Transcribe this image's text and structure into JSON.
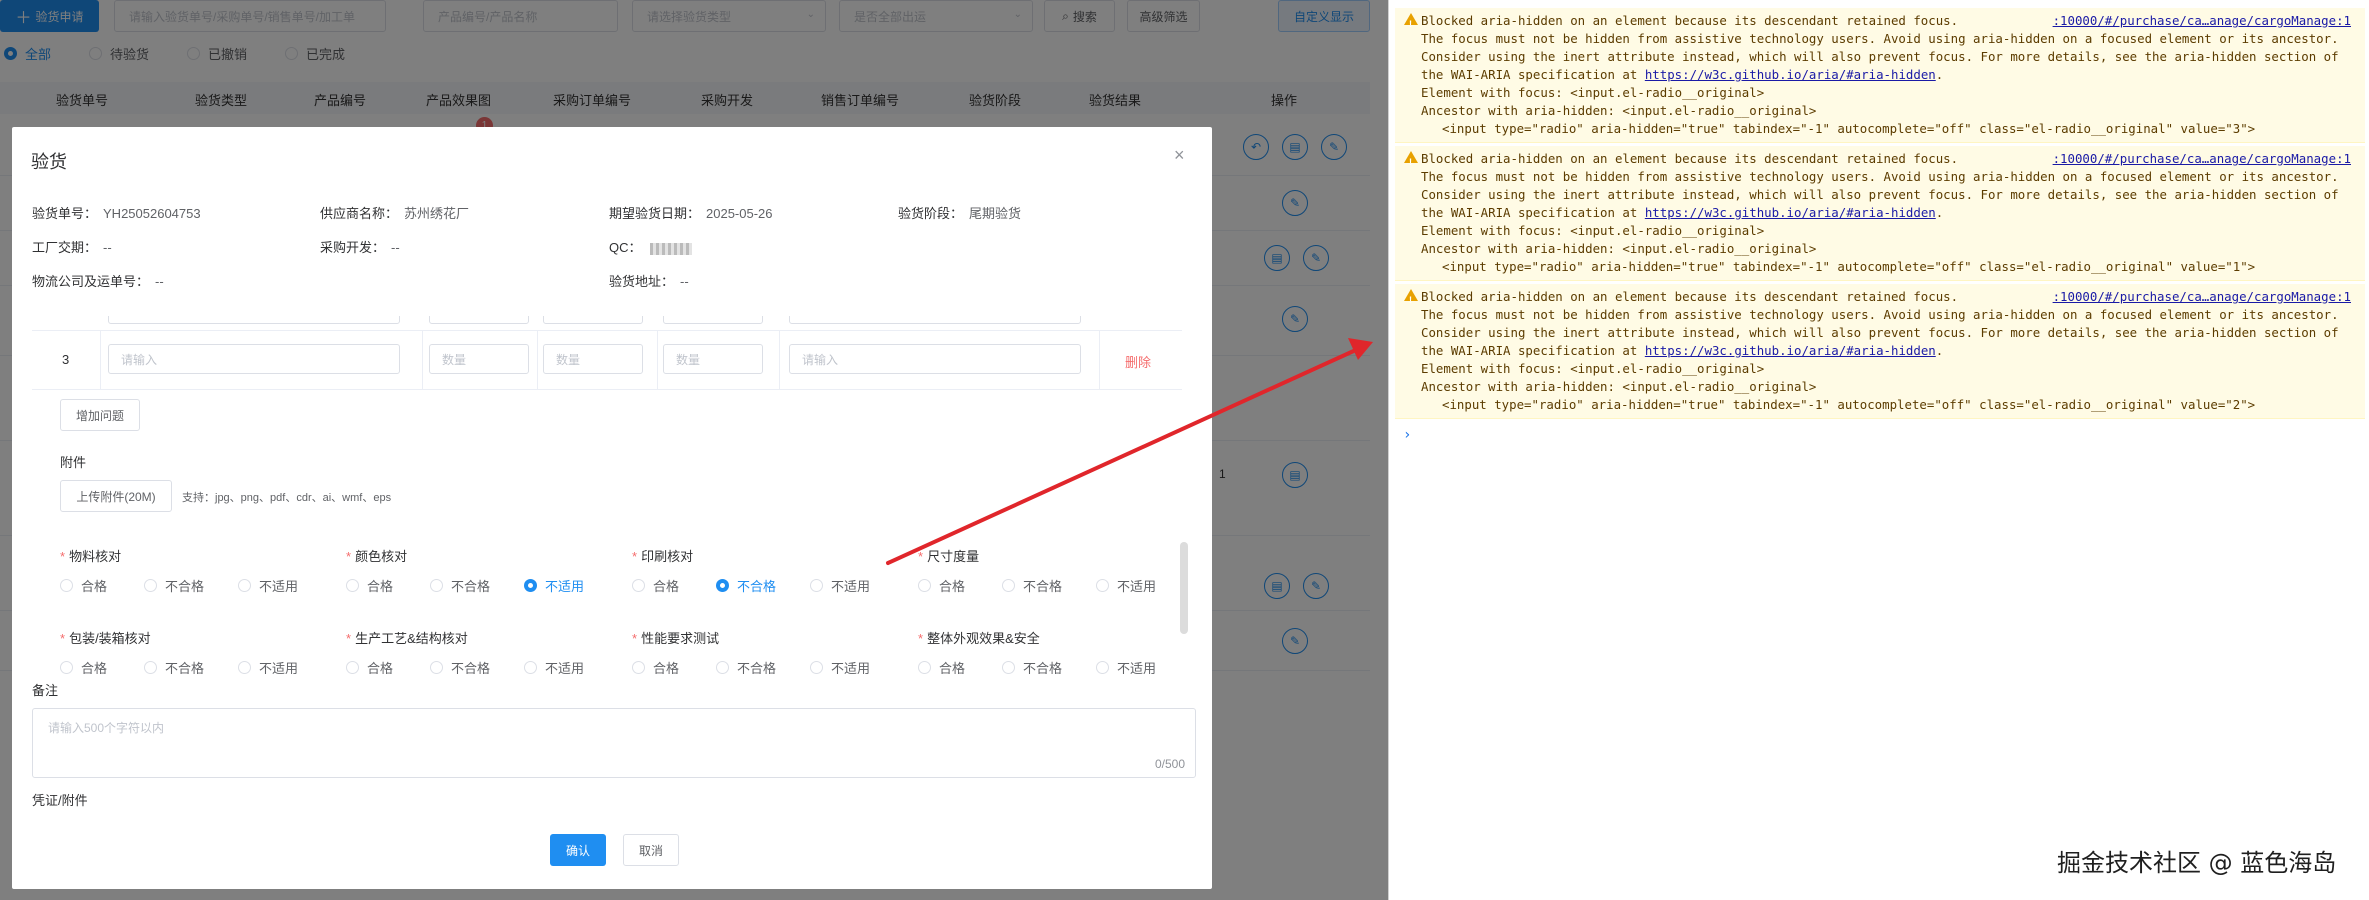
{
  "toolbar": {
    "apply_button": "验货申请",
    "search_placeholder": "请输入验货单号/采购单号/销售单号/加工单",
    "product_placeholder": "产品编号/产品名称",
    "type_placeholder": "请选择验货类型",
    "export_placeholder": "是否全部出运",
    "search_button": "搜索",
    "advanced_button": "高级筛选",
    "custom_display_button": "自定义显示"
  },
  "status_filters": [
    {
      "label": "全部",
      "selected": true
    },
    {
      "label": "待验货",
      "selected": false
    },
    {
      "label": "已撤销",
      "selected": false
    },
    {
      "label": "已完成",
      "selected": false
    }
  ],
  "table": {
    "columns": [
      "验货单号",
      "验货类型",
      "产品编号",
      "产品效果图",
      "采购订单编号",
      "采购开发",
      "销售订单编号",
      "验货阶段",
      "验货结果",
      "操作"
    ],
    "badge": "1",
    "row_fragment": "1"
  },
  "dialog": {
    "title": "验货",
    "close": "×",
    "info": {
      "order_no_label": "验货单号：",
      "order_no": "YH25052604753",
      "supplier_label": "供应商名称：",
      "supplier": "苏州绣花厂",
      "expected_date_label": "期望验货日期：",
      "expected_date": "2025-05-26",
      "stage_label": "验货阶段：",
      "stage": "尾期验货",
      "factory_date_label": "工厂交期：",
      "factory_date": "--",
      "purchase_dev_label": "采购开发：",
      "purchase_dev": "--",
      "qc_label": "QC：",
      "logistics_label": "物流公司及运单号：",
      "logistics": "--",
      "address_label": "验货地址：",
      "address": "--"
    },
    "issue_row": {
      "index": "3",
      "desc_placeholder": "请输入",
      "qty_placeholder_1": "数量",
      "qty_placeholder_2": "数量",
      "qty_placeholder_3": "数量",
      "remark_placeholder": "请输入",
      "delete": "删除"
    },
    "add_issue_button": "增加问题",
    "attachment": {
      "label": "附件",
      "upload_button": "上传附件(20M)",
      "support_text": "支持：jpg、png、pdf、cdr、ai、wmf、eps"
    },
    "checks": [
      {
        "label": "物料核对",
        "selected": null
      },
      {
        "label": "颜色核对",
        "selected": 2
      },
      {
        "label": "印刷核对",
        "selected": 1
      },
      {
        "label": "尺寸度量",
        "selected": null
      },
      {
        "label": "包装/装箱核对",
        "selected": null
      },
      {
        "label": "生产工艺&结构核对",
        "selected": null
      },
      {
        "label": "性能要求测试",
        "selected": null
      },
      {
        "label": "整体外观效果&安全",
        "selected": null
      }
    ],
    "options": [
      "合格",
      "不合格",
      "不适用"
    ],
    "remark": {
      "label": "备注",
      "placeholder": "请输入500个字符以内",
      "counter": "0/500"
    },
    "voucher_label": "凭证/附件",
    "confirm_button": "确认",
    "cancel_button": "取消"
  },
  "console": {
    "warnings": [
      {
        "line1": "Blocked aria-hidden on an element because its descendant retained focus.",
        "source": ":10000/#/purchase/ca…anage/cargoManage:1",
        "body": "The focus must not be hidden from assistive technology users. Avoid using aria-hidden on a focused element or its ancestor. Consider using the inert attribute instead, which will also prevent focus. For more details, see the aria-hidden section of the WAI-ARIA specification at",
        "link": "https://w3c.github.io/aria/#aria-hidden",
        "focus": "Element with focus: <input.el-radio__original>",
        "ancestor": "Ancestor with aria-hidden: <input.el-radio__original>",
        "code": "<input type=\"radio\" aria-hidden=\"true\" tabindex=\"-1\" autocomplete=\"off\" class=\"el-radio__original\" value=\"3\">"
      },
      {
        "line1": "Blocked aria-hidden on an element because its descendant retained focus.",
        "source": ":10000/#/purchase/ca…anage/cargoManage:1",
        "body": "The focus must not be hidden from assistive technology users. Avoid using aria-hidden on a focused element or its ancestor. Consider using the inert attribute instead, which will also prevent focus. For more details, see the aria-hidden section of the WAI-ARIA specification at",
        "link": "https://w3c.github.io/aria/#aria-hidden",
        "focus": "Element with focus: <input.el-radio__original>",
        "ancestor": "Ancestor with aria-hidden: <input.el-radio__original>",
        "code": "<input type=\"radio\" aria-hidden=\"true\" tabindex=\"-1\" autocomplete=\"off\" class=\"el-radio__original\" value=\"1\">"
      },
      {
        "line1": "Blocked aria-hidden on an element because its descendant retained focus.",
        "source": ":10000/#/purchase/ca…anage/cargoManage:1",
        "body": "The focus must not be hidden from assistive technology users. Avoid using aria-hidden on a focused element or its ancestor. Consider using the inert attribute instead, which will also prevent focus. For more details, see the aria-hidden section of the WAI-ARIA specification at",
        "link": "https://w3c.github.io/aria/#aria-hidden",
        "focus": "Element with focus: <input.el-radio__original>",
        "ancestor": "Ancestor with aria-hidden: <input.el-radio__original>",
        "code": "<input type=\"radio\" aria-hidden=\"true\" tabindex=\"-1\" autocomplete=\"off\" class=\"el-radio__original\" value=\"2\">"
      }
    ],
    "prompt": "›"
  },
  "watermark": "掘金技术社区 @ 蓝色海岛",
  "colors": {
    "primary": "#1f8ef1",
    "danger": "#f56c6c",
    "warning_bg": "#fffbe5",
    "warning_icon": "#e8a100",
    "arrow": "#e0262b"
  }
}
